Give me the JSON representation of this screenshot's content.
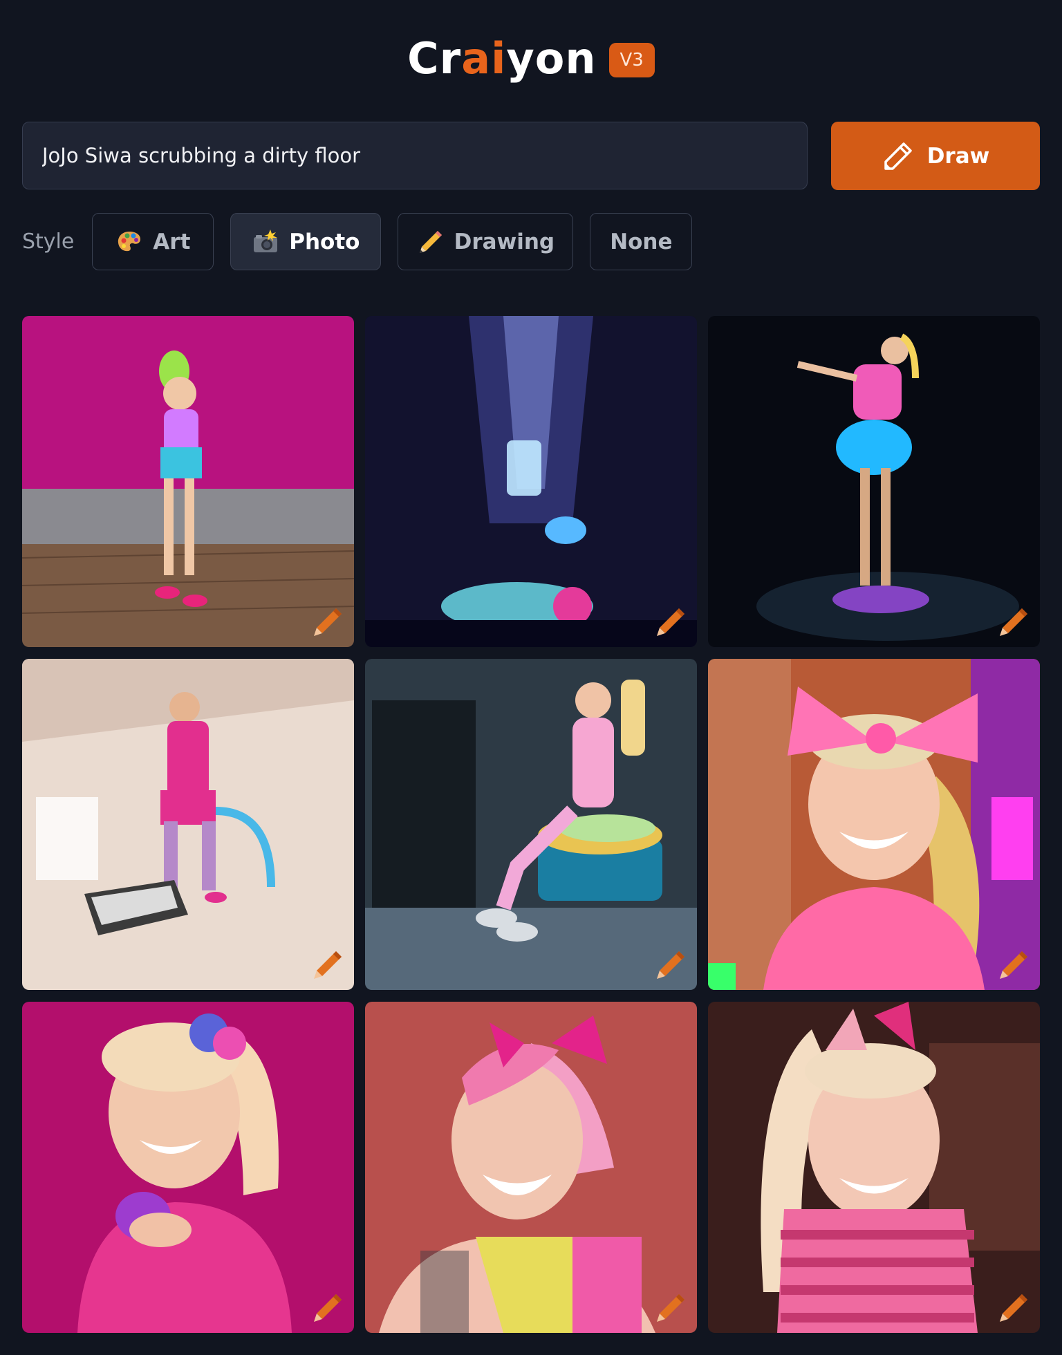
{
  "app": {
    "logo_parts": [
      "Cr",
      "ai",
      "yon"
    ],
    "version": "V3"
  },
  "prompt": {
    "value": "JoJo Siwa scrubbing a dirty floor"
  },
  "draw_button": {
    "label": "Draw",
    "icon": "pencil-icon"
  },
  "style": {
    "label": "Style",
    "options": [
      {
        "label": "Art",
        "icon": "palette-icon",
        "active": false
      },
      {
        "label": "Photo",
        "icon": "camera-flash-icon",
        "active": true
      },
      {
        "label": "Drawing",
        "icon": "pencil-icon",
        "active": false
      },
      {
        "label": "None",
        "icon": "",
        "active": false
      }
    ]
  },
  "images": [
    {
      "icon": "edit-pencil-icon",
      "colors": [
        "#b8127f",
        "#d6e06a"
      ]
    },
    {
      "icon": "edit-pencil-icon",
      "colors": [
        "#1a1b40",
        "#7fd6ff"
      ]
    },
    {
      "icon": "edit-pencil-icon",
      "colors": [
        "#06090f",
        "#3fc8ff"
      ]
    },
    {
      "icon": "edit-pencil-icon",
      "colors": [
        "#e9d9cf",
        "#e22f8e"
      ]
    },
    {
      "icon": "edit-pencil-icon",
      "colors": [
        "#2d3a45",
        "#f6a7d2"
      ]
    },
    {
      "icon": "edit-pencil-icon",
      "colors": [
        "#b85a36",
        "#ff74b5"
      ]
    },
    {
      "icon": "edit-pencil-icon",
      "colors": [
        "#b30f6c",
        "#f6d7b5"
      ]
    },
    {
      "icon": "edit-pencil-icon",
      "colors": [
        "#b8504d",
        "#f5cfc1"
      ]
    },
    {
      "icon": "edit-pencil-icon",
      "colors": [
        "#3a1e1c",
        "#f4ddc3"
      ]
    }
  ],
  "colors": {
    "background": "#111520",
    "accent": "#d35b16",
    "logo_accent": "#e8641c"
  }
}
